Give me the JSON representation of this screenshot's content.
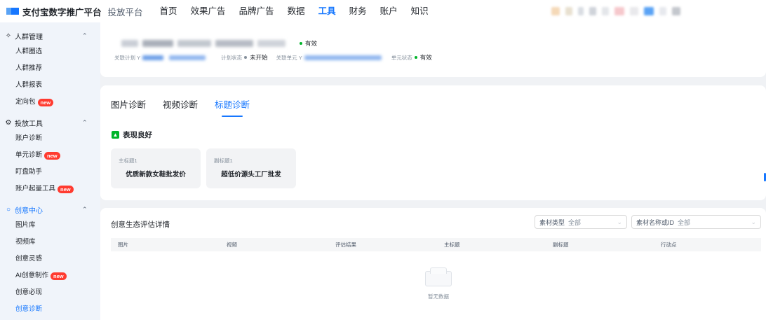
{
  "topnav": {
    "brand": "支付宝数字推广平台",
    "sub": "投放平台",
    "items": [
      {
        "label": "首页",
        "active": false
      },
      {
        "label": "效果广告",
        "active": false
      },
      {
        "label": "品牌广告",
        "active": false
      },
      {
        "label": "数据",
        "active": false
      },
      {
        "label": "工具",
        "active": true
      },
      {
        "label": "财务",
        "active": false
      },
      {
        "label": "账户",
        "active": false
      },
      {
        "label": "知识",
        "active": false
      }
    ]
  },
  "sidebar": {
    "groups": [
      {
        "label": "人群管理",
        "icon": "crowd-icon",
        "items": [
          {
            "label": "人群圈选"
          },
          {
            "label": "人群推荐"
          },
          {
            "label": "人群报表"
          },
          {
            "label": "定向包",
            "badge": "new"
          }
        ]
      },
      {
        "label": "投放工具",
        "icon": "gear-icon",
        "items": [
          {
            "label": "账户诊断"
          },
          {
            "label": "单元诊断",
            "badge": "new"
          },
          {
            "label": "盯盘助手"
          },
          {
            "label": "账户起量工具",
            "badge": "new"
          }
        ]
      },
      {
        "label": "创意中心",
        "icon": "bulb-icon",
        "active": true,
        "items": [
          {
            "label": "图片库"
          },
          {
            "label": "视频库"
          },
          {
            "label": "创意灵感"
          },
          {
            "label": "AI创意制作",
            "badge": "new"
          },
          {
            "label": "创意必现"
          },
          {
            "label": "创意诊断",
            "active": true
          }
        ]
      }
    ]
  },
  "plan_card": {
    "status_top": "有效",
    "plan_label": "关联计划 Y",
    "plan_status_label": "计划状态",
    "plan_status": "未开始",
    "unit_label": "关联单元 Y",
    "unit_status_label": "单元状态",
    "unit_status": "有效"
  },
  "diagnosis": {
    "tabs": [
      {
        "label": "图片诊断",
        "active": false
      },
      {
        "label": "视频诊断",
        "active": false
      },
      {
        "label": "标题诊断",
        "active": true
      }
    ],
    "performance": "表现良好",
    "titles": [
      {
        "label": "主标题1",
        "text": "优质新款女鞋批发价"
      },
      {
        "label": "副标题1",
        "text": "超低价源头工厂批发"
      }
    ]
  },
  "eval": {
    "title": "创意生态评估详情",
    "filter_type_label": "素材类型",
    "filter_type_value": "全部",
    "filter_name_label": "素材名称或ID",
    "filter_name_value": "全部",
    "columns": [
      "图片",
      "视频",
      "评估结果",
      "主标题",
      "副标题",
      "行动点"
    ],
    "empty_text": "暂无数据"
  },
  "colors": {
    "accent": "#1677ff",
    "badge": "#ff3b30",
    "status_green": "#00b42a"
  }
}
